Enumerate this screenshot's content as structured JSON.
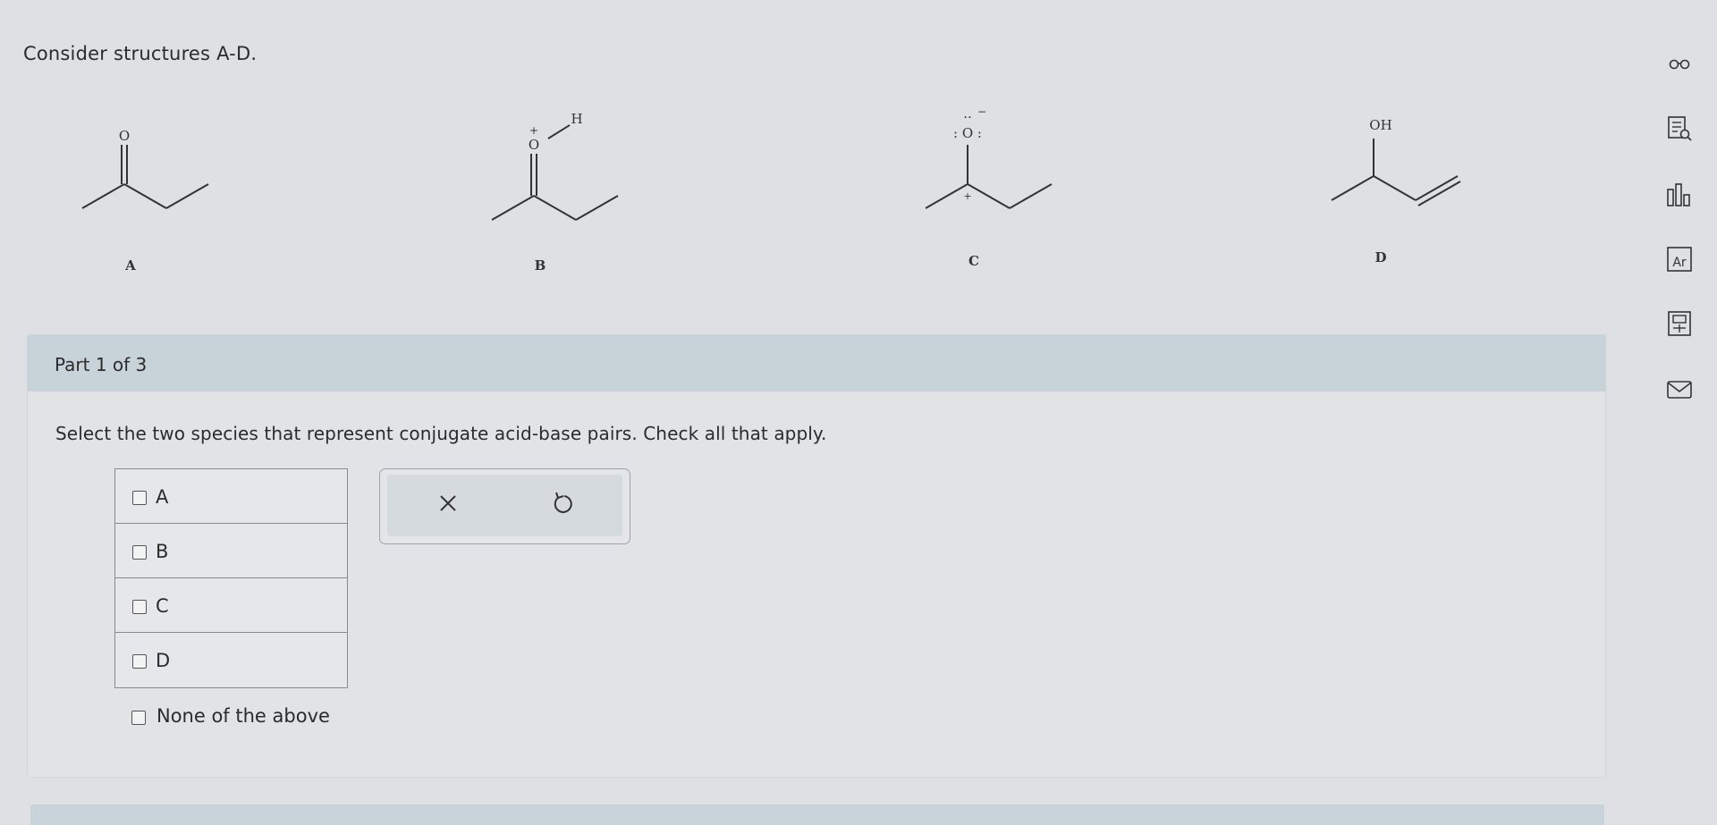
{
  "prompt": "Consider structures A-D.",
  "structures": {
    "A": {
      "label": "A",
      "atom": "O"
    },
    "B": {
      "label": "B",
      "atom": "O",
      "charge": "+",
      "h": "H"
    },
    "C": {
      "label": "C",
      "atom": ": O :",
      "dots": "··",
      "anion_charge": "−",
      "cation_charge": "+"
    },
    "D": {
      "label": "D",
      "atom": "OH"
    }
  },
  "part": {
    "label": "Part 1 of 3"
  },
  "question": "Select the two species that represent conjugate acid-base pairs. Check all that apply.",
  "choices": [
    {
      "label": "A",
      "checked": false
    },
    {
      "label": "B",
      "checked": false
    },
    {
      "label": "C",
      "checked": false
    },
    {
      "label": "D",
      "checked": false
    }
  ],
  "none_option": {
    "label": "None of the above",
    "checked": false
  },
  "tools": {
    "clear_icon": "x-icon",
    "reset_icon": "undo-icon"
  },
  "sidebar_icons": [
    "glasses-icon",
    "reference-icon",
    "bar-chart-icon",
    "periodic-table-icon",
    "calculator-icon",
    "mail-icon"
  ],
  "colors": {
    "background": "#dfe0e4",
    "part_bar": "#c8d3d9",
    "panel": "#e2e3e7"
  }
}
